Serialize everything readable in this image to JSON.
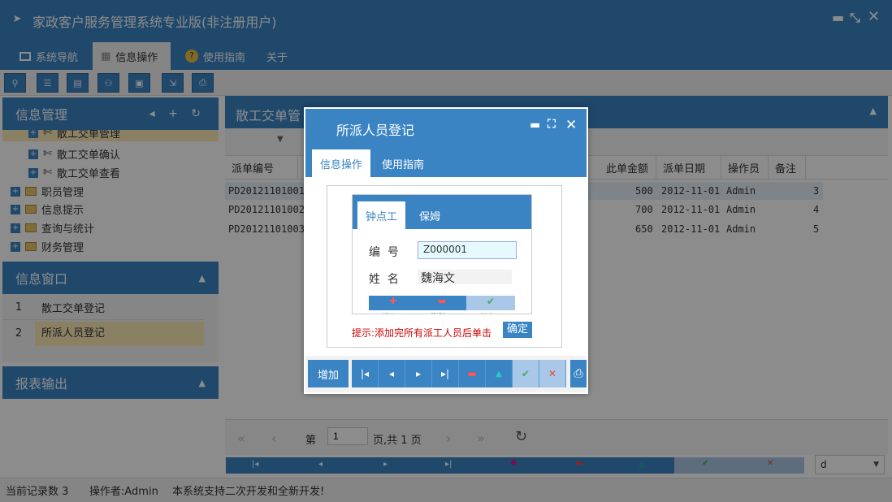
{
  "window": {
    "title": "家政客户服务管理系统专业版(非注册用户)",
    "controls": [
      "minimize",
      "restore",
      "close"
    ]
  },
  "menu": {
    "tabs": [
      {
        "label": "系统导航",
        "icon": "monitor-icon"
      },
      {
        "label": "信息操作",
        "icon": "grid-icon"
      },
      {
        "label": "使用指南",
        "icon": "help-icon"
      },
      {
        "label": "关于",
        "icon": ""
      }
    ]
  },
  "toolbar": {
    "buttons": [
      "search-icon",
      "list-icon",
      "document-icon",
      "users-icon",
      "print-preview-icon",
      "export-icon",
      "print-icon"
    ]
  },
  "left": {
    "info_panel": {
      "title": "信息管理",
      "tree": [
        {
          "label": "散工交单管理",
          "level": 2
        },
        {
          "label": "散工交单确认",
          "level": 2
        },
        {
          "label": "散工交单查看",
          "level": 2
        },
        {
          "label": "职员管理",
          "level": 1
        },
        {
          "label": "信息提示",
          "level": 1
        },
        {
          "label": "查询与统计",
          "level": 1
        },
        {
          "label": "财务管理",
          "level": 1
        }
      ]
    },
    "window_panel": {
      "title": "信息窗口",
      "items": [
        {
          "num": "1",
          "label": "散工交单登记"
        },
        {
          "num": "2",
          "label": "所派人员登记"
        }
      ]
    },
    "report_panel": {
      "title": "报表输出"
    }
  },
  "main": {
    "title": "散工交单管",
    "columns": [
      "派单编号",
      "此单金额",
      "派单日期",
      "操作员",
      "备注"
    ],
    "rows": [
      {
        "id": "PD20121101001",
        "amount": "500",
        "date": "2012-11-01",
        "op": "Admin",
        "note": "3"
      },
      {
        "id": "PD20121101002",
        "amount": "700",
        "date": "2012-11-01",
        "op": "Admin",
        "note": "4"
      },
      {
        "id": "PD20121101003",
        "amount": "650",
        "date": "2012-11-01",
        "op": "Admin",
        "note": "5"
      }
    ],
    "pager": {
      "page_label": "第",
      "page": "1",
      "total": "页,共 1 页"
    },
    "combo_value": "d"
  },
  "status": {
    "records": "当前记录数 3",
    "operator": "操作者:Admin",
    "notice": "本系统支持二次开发和全新开发!"
  },
  "dialog": {
    "title": "所派人员登记",
    "tabs": [
      "信息操作",
      "使用指南"
    ],
    "inner_tabs": [
      "钟点工",
      "保姆"
    ],
    "fields": {
      "code_label": "编  号",
      "code_value": "Z000001",
      "name_label": "姓  名",
      "name_value": "魏海文"
    },
    "hint": "提示:添加完所有派工人员后单击",
    "confirm": "确定",
    "add": "增加",
    "subbtn_labels": [
      "添加",
      "删除",
      "保存"
    ]
  }
}
